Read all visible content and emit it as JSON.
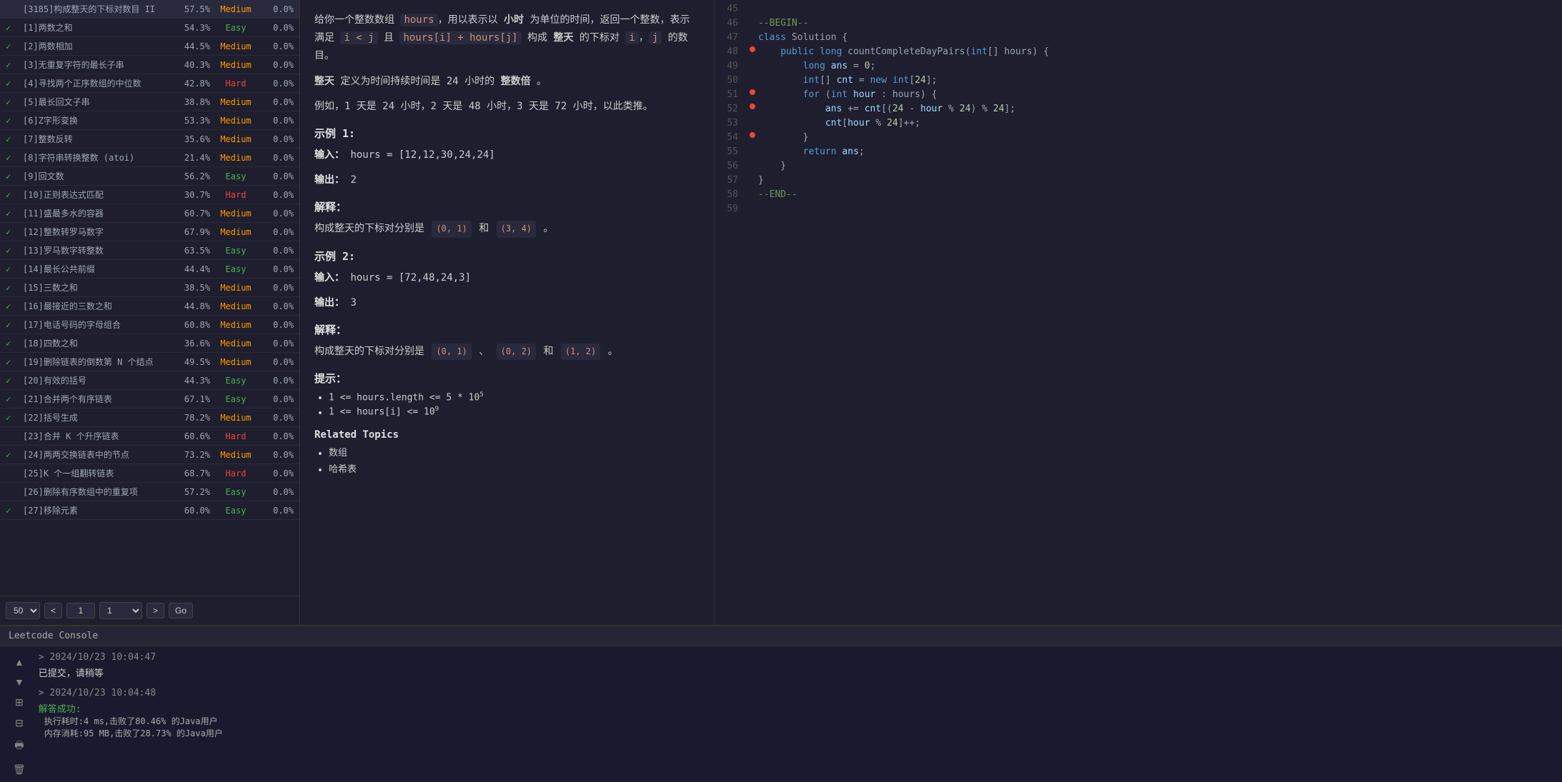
{
  "problems": [
    {
      "id": "[3185]构成整天的下标对数目 II",
      "pct": "57.5%",
      "diff": "Medium",
      "rate": "0.0%",
      "checked": false
    },
    {
      "id": "[1]两数之和",
      "pct": "54.3%",
      "diff": "Easy",
      "rate": "0.0%",
      "checked": true
    },
    {
      "id": "[2]两数相加",
      "pct": "44.5%",
      "diff": "Medium",
      "rate": "0.0%",
      "checked": true
    },
    {
      "id": "[3]无重复字符的最长子串",
      "pct": "40.3%",
      "diff": "Medium",
      "rate": "0.0%",
      "checked": true
    },
    {
      "id": "[4]寻找两个正序数组的中位数",
      "pct": "42.8%",
      "diff": "Hard",
      "rate": "0.0%",
      "checked": true
    },
    {
      "id": "[5]最长回文子串",
      "pct": "38.8%",
      "diff": "Medium",
      "rate": "0.0%",
      "checked": true
    },
    {
      "id": "[6]Z字形变换",
      "pct": "53.3%",
      "diff": "Medium",
      "rate": "0.0%",
      "checked": true
    },
    {
      "id": "[7]整数反转",
      "pct": "35.6%",
      "diff": "Medium",
      "rate": "0.0%",
      "checked": true
    },
    {
      "id": "[8]字符串转换整数 (atoi)",
      "pct": "21.4%",
      "diff": "Medium",
      "rate": "0.0%",
      "checked": true
    },
    {
      "id": "[9]回文数",
      "pct": "56.2%",
      "diff": "Easy",
      "rate": "0.0%",
      "checked": true
    },
    {
      "id": "[10]正则表达式匹配",
      "pct": "30.7%",
      "diff": "Hard",
      "rate": "0.0%",
      "checked": true
    },
    {
      "id": "[11]盛最多水的容器",
      "pct": "60.7%",
      "diff": "Medium",
      "rate": "0.0%",
      "checked": true
    },
    {
      "id": "[12]整数转罗马数字",
      "pct": "67.9%",
      "diff": "Medium",
      "rate": "0.0%",
      "checked": true
    },
    {
      "id": "[13]罗马数字转整数",
      "pct": "63.5%",
      "diff": "Easy",
      "rate": "0.0%",
      "checked": true
    },
    {
      "id": "[14]最长公共前缀",
      "pct": "44.4%",
      "diff": "Easy",
      "rate": "0.0%",
      "checked": true
    },
    {
      "id": "[15]三数之和",
      "pct": "38.5%",
      "diff": "Medium",
      "rate": "0.0%",
      "checked": true
    },
    {
      "id": "[16]最接近的三数之和",
      "pct": "44.8%",
      "diff": "Medium",
      "rate": "0.0%",
      "checked": true
    },
    {
      "id": "[17]电话号码的字母组合",
      "pct": "60.8%",
      "diff": "Medium",
      "rate": "0.0%",
      "checked": true
    },
    {
      "id": "[18]四数之和",
      "pct": "36.6%",
      "diff": "Medium",
      "rate": "0.0%",
      "checked": true
    },
    {
      "id": "[19]删除链表的倒数第 N 个结点",
      "pct": "49.5%",
      "diff": "Medium",
      "rate": "0.0%",
      "checked": true
    },
    {
      "id": "[20]有效的括号",
      "pct": "44.3%",
      "diff": "Easy",
      "rate": "0.0%",
      "checked": true
    },
    {
      "id": "[21]合并两个有序链表",
      "pct": "67.1%",
      "diff": "Easy",
      "rate": "0.0%",
      "checked": true
    },
    {
      "id": "[22]括号生成",
      "pct": "78.2%",
      "diff": "Medium",
      "rate": "0.0%",
      "checked": true
    },
    {
      "id": "[23]合并 K 个升序链表",
      "pct": "60.6%",
      "diff": "Hard",
      "rate": "0.0%",
      "checked": false
    },
    {
      "id": "[24]两两交换链表中的节点",
      "pct": "73.2%",
      "diff": "Medium",
      "rate": "0.0%",
      "checked": true
    },
    {
      "id": "[25]K 个一组翻转链表",
      "pct": "68.7%",
      "diff": "Hard",
      "rate": "0.0%",
      "checked": false
    },
    {
      "id": "[26]删除有序数组中的重复项",
      "pct": "57.2%",
      "diff": "Easy",
      "rate": "0.0%",
      "checked": false
    },
    {
      "id": "[27]移除元素",
      "pct": "60.0%",
      "diff": "Easy",
      "rate": "0.0%",
      "checked": true
    }
  ],
  "pagination": {
    "per_page": "50",
    "prev": "<",
    "page": "1",
    "next": ">",
    "go": "Go"
  },
  "description": {
    "intro": "给你一个整数数组 hours，用以表示以 小时 为单位的时间，返回一个整数，表示满足 i < j 且 hours[i] + hours[j] 构成 整天 的下标对 i，j 的数目。",
    "whole_day_def": "整天 定义为时间持续时间是 24 小时的 整数倍 。",
    "example_note": "例如，1 天是 24 小时，2 天是 48 小时，3 天是 72 小时，以此类推。",
    "example1_title": "示例 1:",
    "example1_input_label": "输入：",
    "example1_input_value": "hours = [12,12,30,24,24]",
    "example1_output_label": "输出：",
    "example1_output_value": "2",
    "example1_explain_title": "解释：",
    "example1_explain": "构成整天的下标对分别是",
    "example1_tag1": "(0, 1)",
    "example1_and": "和",
    "example1_tag2": "(3, 4)",
    "example2_title": "示例 2:",
    "example2_input_label": "输入：",
    "example2_input_value": "hours = [72,48,24,3]",
    "example2_output_label": "输出：",
    "example2_output_value": "3",
    "example2_explain_title": "解释：",
    "example2_explain": "构成整天的下标对分别是",
    "example2_tag1": "(0, 1)",
    "example2_sep1": "、",
    "example2_tag2": "(0, 2)",
    "example2_and": "和",
    "example2_tag3": "(1, 2)",
    "hints_title": "提示：",
    "hint1": "1 <= hours.length <= 5 * 10",
    "hint1_sup": "5",
    "hint2": "1 <= hours[i] <= 10",
    "hint2_sup": "9",
    "related_title": "Related Topics",
    "topics": [
      "数组",
      "哈希表"
    ]
  },
  "code_lines": [
    {
      "num": "45",
      "gutter": false,
      "code": ""
    },
    {
      "num": "46",
      "gutter": false,
      "code": "--BEGIN--",
      "class": "comment"
    },
    {
      "num": "47",
      "gutter": false,
      "code": "class Solution {",
      "class": "normal"
    },
    {
      "num": "48",
      "gutter": true,
      "code": "    public long countCompleteDayPairs(int[] hours) {",
      "class": "normal"
    },
    {
      "num": "49",
      "gutter": false,
      "code": "        long ans = 0;",
      "class": "normal"
    },
    {
      "num": "50",
      "gutter": false,
      "code": "        int[] cnt = new int[24];",
      "class": "normal"
    },
    {
      "num": "51",
      "gutter": true,
      "code": "        for (int hour : hours) {",
      "class": "normal"
    },
    {
      "num": "52",
      "gutter": true,
      "code": "            ans += cnt[(24 - hour % 24) % 24];",
      "class": "normal"
    },
    {
      "num": "53",
      "gutter": false,
      "code": "            cnt[hour % 24]++;",
      "class": "normal"
    },
    {
      "num": "54",
      "gutter": true,
      "code": "        }",
      "class": "normal"
    },
    {
      "num": "55",
      "gutter": false,
      "code": "        return ans;",
      "class": "normal"
    },
    {
      "num": "56",
      "gutter": false,
      "code": "    }",
      "class": "normal"
    },
    {
      "num": "57",
      "gutter": false,
      "code": "}",
      "class": "normal"
    },
    {
      "num": "58",
      "gutter": false,
      "code": "--END--",
      "class": "comment"
    },
    {
      "num": "59",
      "gutter": false,
      "code": "",
      "class": "normal"
    }
  ],
  "console": {
    "title": "Leetcode Console",
    "entries": [
      {
        "timestamp": "> 2024/10/23 10:04:47",
        "message": "已提交，请稍等"
      },
      {
        "timestamp": "> 2024/10/23 10:04:48",
        "success": "解答成功:",
        "details": [
          "执行耗时:4 ms,击败了80.46% 的Java用户",
          "内存消耗:95 MB,击败了28.73% 的Java用户"
        ]
      }
    ]
  }
}
